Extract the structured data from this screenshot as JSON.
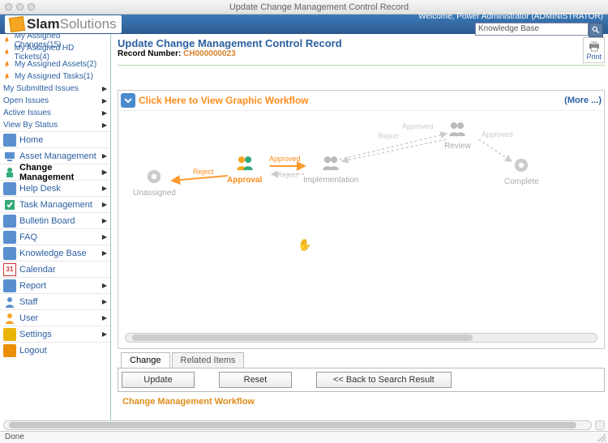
{
  "window": {
    "title": "Update Change Management Control Record"
  },
  "logo": {
    "brand": "Slam",
    "suffix": "Solutions"
  },
  "header": {
    "welcome": "Welcome, Power Administrator (ADMINISTRATOR)",
    "search_value": "Knowledge Base"
  },
  "nav": {
    "quick": [
      {
        "label": "My Assigned Changes(15)"
      },
      {
        "label": "My Assigned HD Tickets(4)"
      },
      {
        "label": "My Assigned Assets(2)"
      },
      {
        "label": "My Assigned Tasks(1)"
      },
      {
        "label": "My Submitted Issues",
        "arrow": true
      },
      {
        "label": "Open Issues",
        "arrow": true
      },
      {
        "label": "Active Issues",
        "arrow": true
      },
      {
        "label": "View By Status",
        "arrow": true
      }
    ],
    "sections": [
      {
        "label": "Home",
        "arrow": false
      },
      {
        "label": "Asset Management",
        "arrow": true
      },
      {
        "label": "Change Management",
        "arrow": true,
        "active": true
      },
      {
        "label": "Help Desk",
        "arrow": true
      },
      {
        "label": "Task Management",
        "arrow": true
      },
      {
        "label": "Bulletin Board",
        "arrow": true
      },
      {
        "label": "FAQ",
        "arrow": true
      },
      {
        "label": "Knowledge Base",
        "arrow": true
      },
      {
        "label": "Calendar",
        "arrow": false
      },
      {
        "label": "Report",
        "arrow": true
      },
      {
        "label": "Staff",
        "arrow": true
      },
      {
        "label": "User",
        "arrow": true
      },
      {
        "label": "Settings",
        "arrow": true
      },
      {
        "label": "Logout",
        "arrow": false
      }
    ]
  },
  "record": {
    "title": "Update Change Management Control Record",
    "number_label": "Record Number:",
    "number_value": "CH000000023",
    "print": "Print"
  },
  "workflow": {
    "link_text": "Click Here to View Graphic Workflow",
    "more": "(More ...)",
    "nodes": {
      "unassigned": "Unassigned",
      "approval": "Approval",
      "implementation": "Implementation",
      "review": "Review",
      "complete": "Complete"
    },
    "edges": {
      "reject1": "Reject",
      "approved1": "Approved",
      "reject2": "Reject",
      "reject3": "Reject",
      "approved2": "Approved",
      "approved3": "Approved"
    }
  },
  "tabs": {
    "change": "Change",
    "related": "Related Items"
  },
  "buttons": {
    "update": "Update",
    "reset": "Reset",
    "back": "<< Back to Search Result"
  },
  "section_title": "Change Management Workflow",
  "status": "Done"
}
